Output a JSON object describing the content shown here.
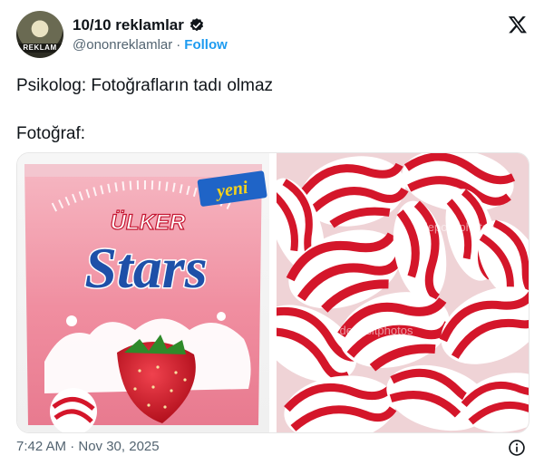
{
  "author": {
    "display_name": "10/10 reklamlar",
    "handle": "@ononreklamlar",
    "separator": "·",
    "follow_label": "Follow",
    "avatar_text": "REKLAM",
    "verified_color": "#0f1419"
  },
  "tweet": {
    "line1": "Psikolog: Fotoğrafların tadı olmaz",
    "line2": "Fotoğraf:"
  },
  "media": {
    "left": {
      "badge": "yeni",
      "brand": "ÜLKER",
      "product": "Stars"
    },
    "right": {
      "watermark": "depositphotos"
    }
  },
  "meta": {
    "timestamp": "7:42 AM · Nov 30, 2025"
  },
  "colors": {
    "accent": "#1d9bf0",
    "candy_red": "#d4162a",
    "pack_pink": "#f2a7b4"
  }
}
